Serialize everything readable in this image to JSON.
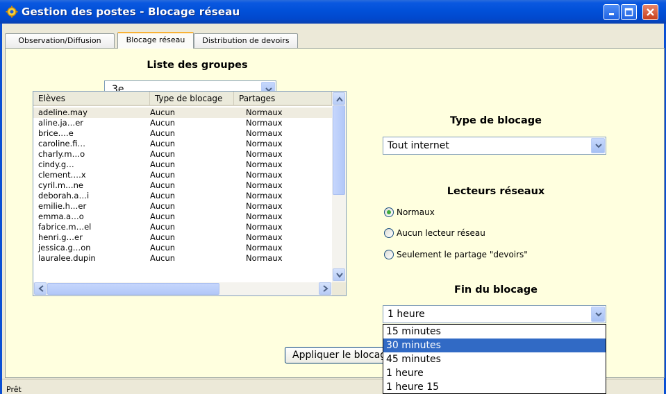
{
  "window": {
    "title": "Gestion des postes - Blocage réseau",
    "icon": "app-gear-icon"
  },
  "tabs": [
    {
      "label": "Observation/Diffusion",
      "active": false
    },
    {
      "label": "Blocage réseau",
      "active": true
    },
    {
      "label": "Distribution de devoirs",
      "active": false
    }
  ],
  "groups": {
    "heading": "Liste des groupes",
    "selected": "3e"
  },
  "students_list": {
    "columns": [
      "Elèves",
      "Type de blocage",
      "Partages"
    ],
    "rows": [
      [
        "adeline.may",
        "Aucun",
        "Normaux"
      ],
      [
        "aline.ja…er",
        "Aucun",
        "Normaux"
      ],
      [
        "brice.…e",
        "Aucun",
        "Normaux"
      ],
      [
        "caroline.fi…",
        "Aucun",
        "Normaux"
      ],
      [
        "charly.m…o",
        "Aucun",
        "Normaux"
      ],
      [
        "cindy.g…",
        "Aucun",
        "Normaux"
      ],
      [
        "clement.…x",
        "Aucun",
        "Normaux"
      ],
      [
        "cyril.m…ne",
        "Aucun",
        "Normaux"
      ],
      [
        "deborah.a…i",
        "Aucun",
        "Normaux"
      ],
      [
        "emilie.h…er",
        "Aucun",
        "Normaux"
      ],
      [
        "emma.a…o",
        "Aucun",
        "Normaux"
      ],
      [
        "fabrice.m…el",
        "Aucun",
        "Normaux"
      ],
      [
        "henri.g…er",
        "Aucun",
        "Normaux"
      ],
      [
        "jessica.g…on",
        "Aucun",
        "Normaux"
      ],
      [
        "lauralee.dupin",
        "Aucun",
        "Normaux"
      ]
    ]
  },
  "blocking_type": {
    "heading": "Type de blocage",
    "selected": "Tout internet"
  },
  "network_drives": {
    "heading": "Lecteurs réseaux",
    "options": [
      {
        "label": "Normaux",
        "checked": true
      },
      {
        "label": "Aucun lecteur réseau",
        "checked": false
      },
      {
        "label": "Seulement le partage \"devoirs\"",
        "checked": false
      }
    ]
  },
  "end_of_blocking": {
    "heading": "Fin du blocage",
    "selected": "1 heure",
    "options": [
      "15 minutes",
      "30 minutes",
      "45 minutes",
      "1 heure",
      "1 heure 15"
    ],
    "highlighted": "30 minutes"
  },
  "apply_button_label": "Appliquer le blocage",
  "status": "Prêt"
}
